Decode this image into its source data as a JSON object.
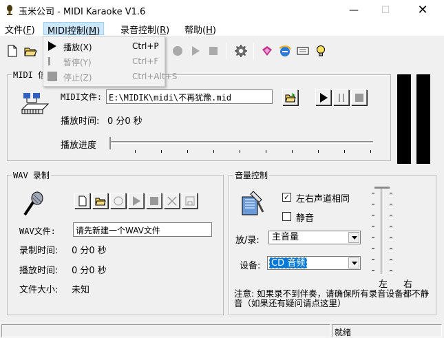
{
  "window": {
    "title": "玉米公司 - MIDI Karaoke V1.6",
    "minimize": "—",
    "maximize": "☐",
    "close": "✕"
  },
  "menu": {
    "file": {
      "label": "文件(",
      "key": "F",
      "end": ")"
    },
    "midi": {
      "label": "MIDI控制(",
      "key": "M",
      "end": ")"
    },
    "record": {
      "label": "录音控制(",
      "key": "R",
      "end": ")"
    },
    "help": {
      "label": "帮助(",
      "key": "H",
      "end": ")"
    }
  },
  "dropdown": {
    "items": [
      {
        "label": "播放(X)",
        "accel": "Ctrl+P",
        "enabled": true
      },
      {
        "label": "暂停(Y)",
        "accel": "Ctrl+F",
        "enabled": false
      },
      {
        "label": "停止(Z)",
        "accel": "Ctrl+Alt+S",
        "enabled": false
      }
    ]
  },
  "midi_group": {
    "title": "MIDI 信",
    "file_label": "MIDI文件:",
    "file_value": "E:\\MIDIK\\midi\\不再犹豫.mid",
    "time_label": "播放时间:",
    "time_value": "0 分0 秒",
    "progress_label": "播放进度",
    "progress": 0
  },
  "wav_group": {
    "title": "WAV 录制",
    "file_label": "WAV文件:",
    "file_value": "请先新建一个WAV文件",
    "rec_time_label": "录制时间:",
    "rec_time_value": "0 分0 秒",
    "play_time_label": "播放时间:",
    "play_time_value": "0 分0 秒",
    "size_label": "文件大小:",
    "size_value": "未知"
  },
  "volume_group": {
    "title": "音量控制",
    "same_channel_label": "左右声道相同",
    "same_channel_checked": true,
    "mute_label": "静音",
    "mute_checked": false,
    "playrec_label": "放/录:",
    "playrec_value": "主音量",
    "device_label": "设备:",
    "device_value": "CD 音频",
    "left_label": "左",
    "right_label": "右",
    "note": "注意: 如果录不到伴奏，请确保所有录音设备都不静音（如果还有疑问请点这里）"
  },
  "statusbar": {
    "text": "就绪"
  },
  "colors": {
    "accent": "#0078d7",
    "menu_highlight": "#cce8ff"
  }
}
